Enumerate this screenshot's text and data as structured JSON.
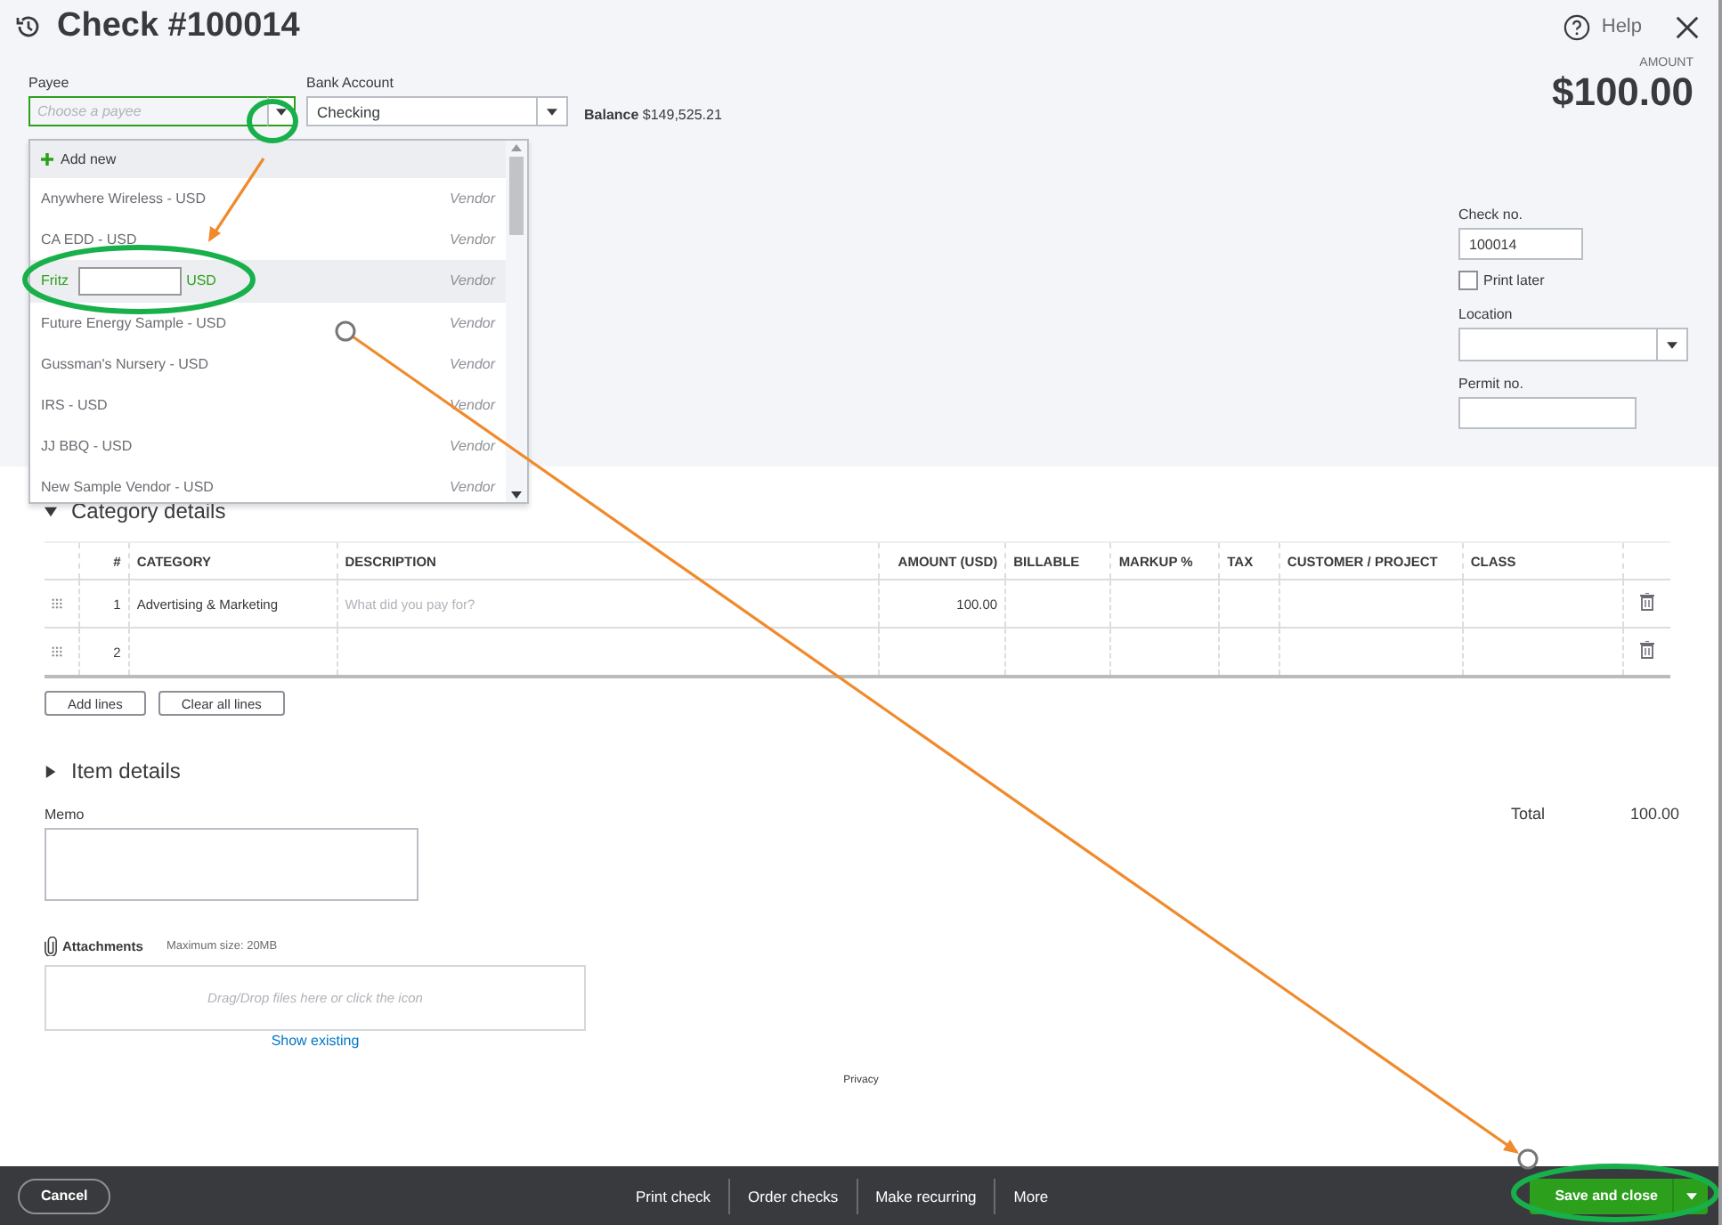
{
  "window": {
    "title": "Check #100014",
    "help": "Help"
  },
  "payee": {
    "label": "Payee",
    "placeholder": "Choose a payee"
  },
  "bank_account": {
    "label": "Bank Account",
    "value": "Checking",
    "balance_label": "Balance",
    "balance": "$149,525.21"
  },
  "amount": {
    "label": "AMOUNT",
    "value": "$100.00"
  },
  "payee_dropdown": {
    "add_new": "Add new",
    "items": [
      {
        "name": "Anywhere Wireless - USD",
        "type": "Vendor",
        "selected": false
      },
      {
        "name": "CA EDD - USD",
        "type": "Vendor",
        "selected": false
      },
      {
        "name": "Fritz",
        "name_end": "USD",
        "type": "Vendor",
        "selected": true
      },
      {
        "name": "Future Energy Sample - USD",
        "type": "Vendor",
        "selected": false
      },
      {
        "name": "Gussman's Nursery - USD",
        "type": "Vendor",
        "selected": false
      },
      {
        "name": "IRS - USD",
        "type": "Vendor",
        "selected": false
      },
      {
        "name": "JJ BBQ - USD",
        "type": "Vendor",
        "selected": false
      },
      {
        "name": "New Sample Vendor - USD",
        "type": "Vendor",
        "selected": false
      }
    ]
  },
  "check_no": {
    "label": "Check no.",
    "value": "100014"
  },
  "print_later": {
    "label": "Print later",
    "checked": false
  },
  "location": {
    "label": "Location"
  },
  "permit_no": {
    "label": "Permit no."
  },
  "category_details": {
    "title": "Category details",
    "expanded": true,
    "columns": [
      "#",
      "CATEGORY",
      "DESCRIPTION",
      "AMOUNT (USD)",
      "BILLABLE",
      "MARKUP %",
      "TAX",
      "CUSTOMER / PROJECT",
      "CLASS"
    ],
    "rows": [
      {
        "number": "1",
        "category": "Advertising & Marketing",
        "description_placeholder": "What did you pay for?",
        "amount": "100.00"
      },
      {
        "number": "2"
      }
    ],
    "buttons": [
      "Add lines",
      "Clear all lines"
    ]
  },
  "item_details": {
    "title": "Item details",
    "expanded": false
  },
  "memo": {
    "label": "Memo"
  },
  "total": {
    "label": "Total",
    "value": "100.00"
  },
  "attachments": {
    "label": "Attachments",
    "max_size": "Maximum size: 20MB",
    "drop_hint": "Drag/Drop files here or click the icon",
    "show_existing": "Show existing"
  },
  "privacy": "Privacy",
  "footer": {
    "cancel": "Cancel",
    "actions": [
      "Print check",
      "Order checks",
      "Make recurring",
      "More"
    ],
    "save": "Save and close"
  }
}
